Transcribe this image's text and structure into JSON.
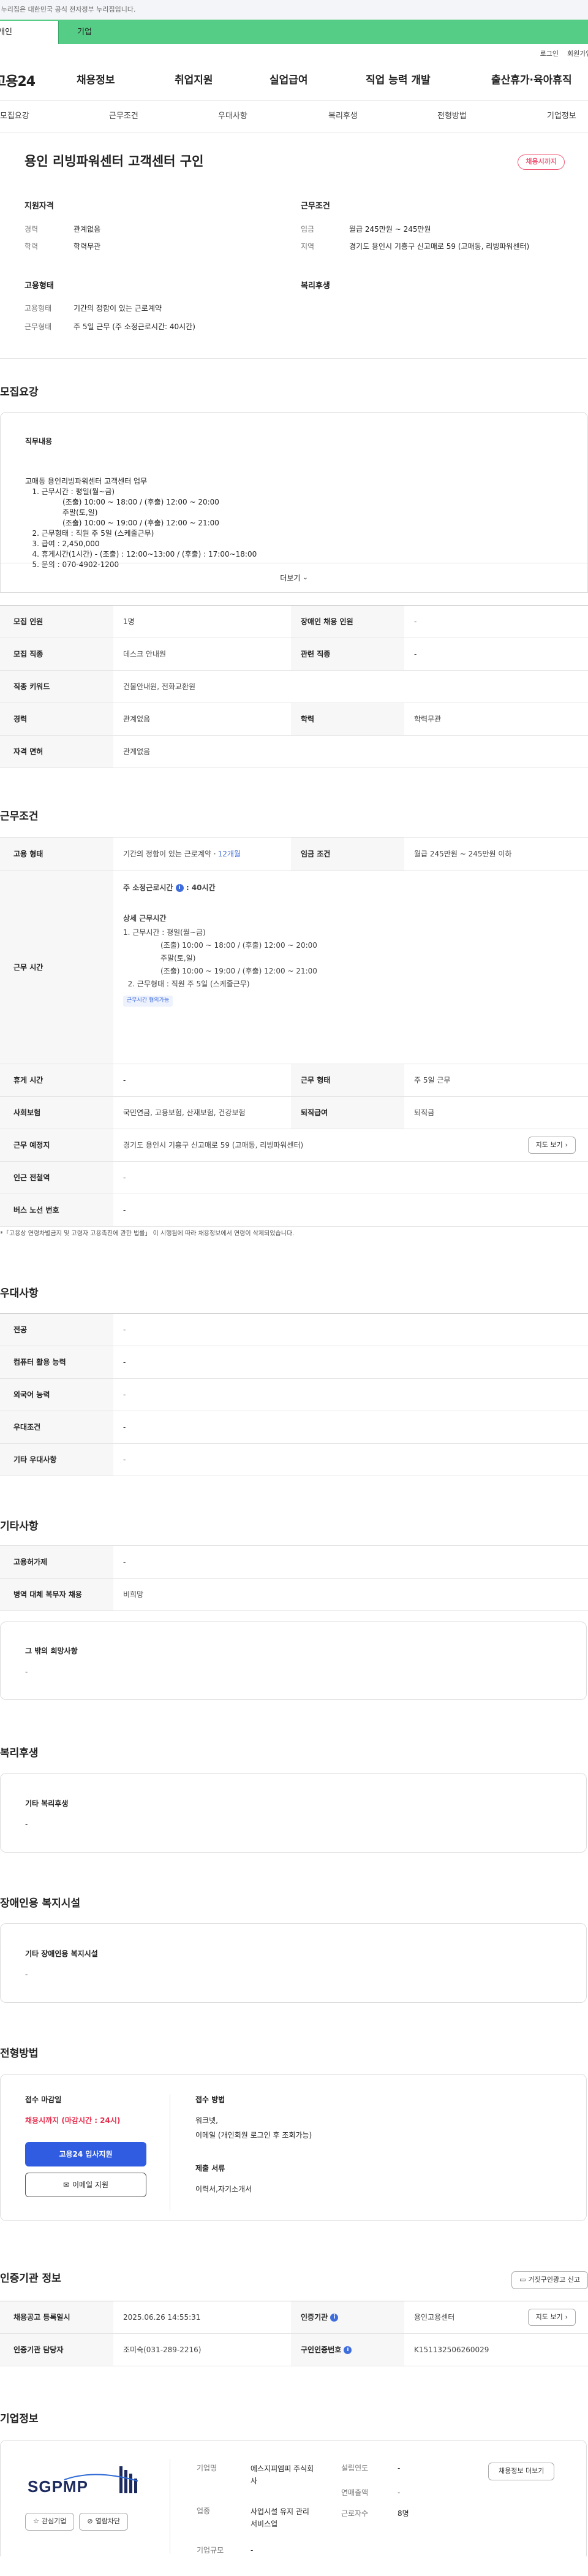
{
  "gov_banner": "이 누리집은 대한민국 공식 전자정부 누리집입니다.",
  "top_tabs": [
    "개인",
    "기업"
  ],
  "util_links": [
    "로그인",
    "회원가입"
  ],
  "logo": "고용24",
  "gnb": [
    "채용정보",
    "취업지원",
    "실업급여",
    "직업 능력 개발",
    "출산휴가·육아휴직"
  ],
  "subnav": [
    "모집요강",
    "근무조건",
    "우대사항",
    "복리후생",
    "전형방법",
    "기업정보"
  ],
  "summary": {
    "title": "용인 리빙파워센터 고객센터 구인",
    "badge": "채용시까지",
    "qualification_heading": "지원자격",
    "career_label": "경력",
    "career_value": "관계없음",
    "education_label": "학력",
    "education_value": "학력무관",
    "conditions_heading": "근무조건",
    "wage_label": "임금",
    "wage_value": "월급 245만원 ~ 245만원",
    "region_label": "지역",
    "region_value": "경기도 용인시 기흥구 신고매로 59 (고매동, 리빙파워센터)",
    "employment_heading": "고용형태",
    "type_label": "고용형태",
    "type_value": "기간의 정함이 있는 근로계약",
    "hours_label": "근무형태",
    "hours_value": "주 5일 근무 (주 소정근로시간: 40시간)",
    "welfare_heading": "복리후생"
  },
  "recruit": {
    "heading": "모집요강",
    "duty_heading": "직무내용",
    "duty_lines": [
      "고매동 용인리빙파워센터 고객센터 업무",
      "   1. 근무시간 : 평일(월~금)",
      "                (조출) 10:00 ~ 18:00 / (후출) 12:00 ~ 20:00",
      "                주말(토,일)",
      "                (조출) 10:00 ~ 19:00 / (후출) 12:00 ~ 21:00",
      "   2. 근무형태 : 직원 주 5일 (스케줄근무)",
      "   3. 급여 : 2,450,000",
      "   4. 휴게시간(1시간) - (조출) : 12:00~13:00 / (후출) : 17:00~18:00",
      "   5. 문의 : 070-4902-1200"
    ],
    "more": "더보기",
    "rows": [
      {
        "th": "모집 인원",
        "td": "1명",
        "th2": "장애인 채용 인원",
        "td2": "-"
      },
      {
        "th": "모집 직종",
        "td": "데스크 안내원",
        "th2": "관련 직종",
        "td2": "-"
      },
      {
        "th": "직종 키워드",
        "td": "건물안내원, 전화교환원"
      },
      {
        "th": "경력",
        "td": "관계없음",
        "th2": "학력",
        "td2": "학력무관"
      },
      {
        "th": "자격 면허",
        "td": "관계없음"
      }
    ]
  },
  "conditions": {
    "heading": "근무조건",
    "type_th": "고용 형태",
    "type_td": "기간의 정함이 있는 근로계약 · ",
    "type_link": "12개월",
    "wage_th": "임금 조건",
    "wage_td": "월급 245만원 ~ 245만원 이하",
    "hours_th": "근무 시간",
    "hours_weekly": "주 소정근로시간",
    "hours_weekly_val": ": 40시간",
    "hours_detail_title": "상세 근무시간",
    "hours_lines": [
      "1. 근무시간 : 평일(월~금)",
      "                (조출) 10:00 ~ 18:00 / (후출) 12:00 ~ 20:00",
      "                주말(토,일)",
      "                (조출) 10:00 ~ 19:00 / (후출) 12:00 ~ 21:00",
      "  2. 근무형태 : 직원 주 5일 (스케줄근무)"
    ],
    "hours_tag": "근무시간 협의가능",
    "break_th": "휴게 시간",
    "break_td": "-",
    "form_th": "근무 형태",
    "form_td": "주 5일 근무",
    "insurance_th": "사회보험",
    "insurance_td": "국민연금, 고용보험, 산재보험, 건강보험",
    "retire_th": "퇴직급여",
    "retire_td": "퇴직금",
    "place_th": "근무 예정지",
    "place_td": "경기도 용인시 기흥구 신고매로 59 (고매동, 리빙파워센터)",
    "map_btn": "지도 보기",
    "subway_th": "인근 전철역",
    "subway_td": "-",
    "bus_th": "버스 노선 번호",
    "bus_td": "-",
    "note": "*「고용상 연령차별금지 및 고령자 고용촉진에 관한 법률」 이 시행됨에 따라 채용정보에서 연령이 삭제되었습니다."
  },
  "preference": {
    "heading": "우대사항",
    "rows": [
      {
        "th": "전공",
        "td": "-"
      },
      {
        "th": "컴퓨터 활용 능력",
        "td": "-"
      },
      {
        "th": "외국어 능력",
        "td": "-"
      },
      {
        "th": "우대조건",
        "td": "-"
      },
      {
        "th": "기타 우대사항",
        "td": "-"
      }
    ]
  },
  "etc": {
    "heading": "기타사항",
    "rows": [
      {
        "th": "고용허가제",
        "td": "-"
      },
      {
        "th": "병역 대체 복무자 채용",
        "td": "비희망"
      }
    ],
    "other_title": "그 밖의 희망사항",
    "other_value": "-"
  },
  "welfare": {
    "heading": "복리후생",
    "box_title": "기타 복리후생",
    "box_value": "-"
  },
  "disability": {
    "heading": "장애인용 복지시설",
    "box_title": "기타 장애인용 복지시설",
    "box_value": "-"
  },
  "selection": {
    "heading": "전형방법",
    "deadline_title": "접수 마감일",
    "deadline_value": "채용시까지 (마감시간 : 24시)",
    "apply_btn": "고용24 입사지원",
    "email_btn": "이메일 지원",
    "method_title": "접수 방법",
    "method_value": "워크넷,",
    "method_value2": "이메일 (개인회원 로그인 후 조회가능)",
    "docs_title": "제출 서류",
    "docs_value": "이력서,자기소개서"
  },
  "agency": {
    "heading": "인증기관 정보",
    "report_btn": "거짓구인광고 신고",
    "reg_th": "채용공고 등록일시",
    "reg_td": "2025.06.26 14:55:31",
    "cert_th": "인증기관",
    "cert_td": "용인고용센터",
    "map_btn": "지도 보기",
    "manager_th": "인증기관 담당자",
    "manager_td": "조미숙(031-289-2216)",
    "id_th": "구인인증번호",
    "id_td": "K151132506260029"
  },
  "company": {
    "heading": "기업정보",
    "logo_text": "SGPMP",
    "interest_btn": "관심기업",
    "block_btn": "열람차단",
    "name_label": "기업명",
    "name_value": "에스지피엠피 주식회사",
    "year_label": "설립연도",
    "year_value": "-",
    "sales_label": "연매출액",
    "sales_value": "-",
    "industry_label": "업종",
    "industry_value": "사업시설 유지 관리 서비스업",
    "staff_label": "근로자수",
    "staff_value": "8명",
    "scale_label": "기업규모",
    "scale_value": "-",
    "jobs_btn": "채용정보 더보기"
  }
}
